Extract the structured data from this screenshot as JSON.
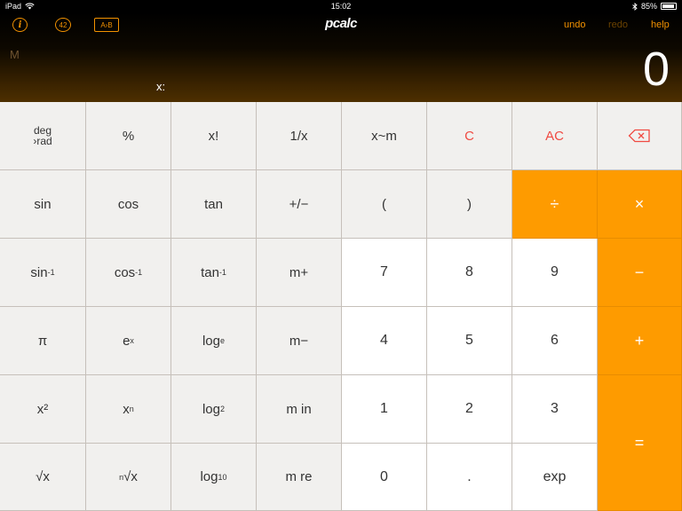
{
  "status": {
    "device": "iPad",
    "time": "15:02",
    "battery": "85%",
    "battery_level": 0.85
  },
  "toolbar": {
    "info_label": "i",
    "answer_label": "42",
    "ab_label": "A›B",
    "logo": "pcalc",
    "undo": "undo",
    "redo": "redo",
    "help": "help"
  },
  "display": {
    "memory": "M",
    "x_label": "x:",
    "value": "0"
  },
  "keys": {
    "deg_top": "deg",
    "deg_bottom": "›rad",
    "percent": "%",
    "factorial": "x!",
    "reciprocal": "1/x",
    "swap_m": "x~m",
    "clear": "C",
    "all_clear": "AC",
    "sin": "sin",
    "cos": "cos",
    "tan": "tan",
    "sign": "+/−",
    "lparen": "(",
    "rparen": ")",
    "divide": "÷",
    "multiply": "×",
    "asin": "sin",
    "acos": "cos",
    "atan": "tan",
    "inv_sup": "-1",
    "m_plus": "m+",
    "seven": "7",
    "eight": "8",
    "nine": "9",
    "minus": "−",
    "pi": "π",
    "exp_base": "e",
    "exp_sup": "x",
    "log_e": "log",
    "log_e_sub": "e",
    "m_minus": "m−",
    "four": "4",
    "five": "5",
    "six": "6",
    "plus": "+",
    "square": "x²",
    "power_base": "x",
    "power_sup": "n",
    "log_2": "log",
    "log_2_sub": "2",
    "m_in": "m in",
    "one": "1",
    "two": "2",
    "three": "3",
    "equals": "=",
    "sqrt": "√x",
    "nroot_sup": "n",
    "nroot": "√x",
    "log_10": "log",
    "log_10_sub": "10",
    "m_re": "m re",
    "zero": "0",
    "dot": ".",
    "exp": "exp"
  }
}
